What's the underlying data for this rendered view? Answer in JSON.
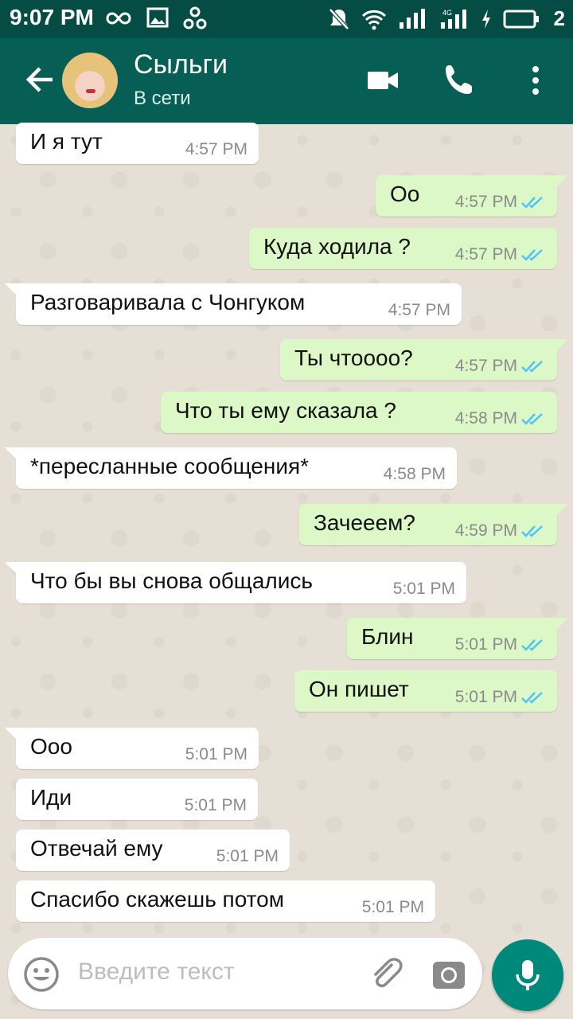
{
  "status_bar": {
    "time": "9:07 PM",
    "battery_level": "2",
    "network_label": "4G"
  },
  "header": {
    "contact_name": "Сыльги",
    "contact_status": "В сети"
  },
  "messages": [
    {
      "dir": "in",
      "text": "И я тут",
      "time": "4:57 PM"
    },
    {
      "dir": "out",
      "text": "Оо",
      "time": "4:57 PM"
    },
    {
      "dir": "out",
      "text": "Куда ходила ?",
      "time": "4:57 PM"
    },
    {
      "dir": "in",
      "text": "Разговаривала с Чонгуком",
      "time": "4:57 PM"
    },
    {
      "dir": "out",
      "text": "Ты чтоооо?",
      "time": "4:57 PM"
    },
    {
      "dir": "out",
      "text": "Что ты ему сказала ?",
      "time": "4:58 PM"
    },
    {
      "dir": "in",
      "text": "*пересланные сообщения*",
      "time": "4:58 PM"
    },
    {
      "dir": "out",
      "text": "Зачееем?",
      "time": "4:59 PM"
    },
    {
      "dir": "in",
      "text": "Что бы вы снова общались",
      "time": "5:01 PM"
    },
    {
      "dir": "out",
      "text": "Блин",
      "time": "5:01 PM"
    },
    {
      "dir": "out",
      "text": "Он пишет",
      "time": "5:01 PM"
    },
    {
      "dir": "in",
      "text": "Ооо",
      "time": "5:01 PM"
    },
    {
      "dir": "in",
      "text": "Иди",
      "time": "5:01 PM"
    },
    {
      "dir": "in",
      "text": "Отвечай ему",
      "time": "5:01 PM"
    },
    {
      "dir": "in",
      "text": "Спасибо скажешь потом",
      "time": "5:01 PM"
    }
  ],
  "composer": {
    "placeholder": "Введите текст"
  },
  "colors": {
    "header": "#075e54",
    "status_bar": "#054d44",
    "outgoing_bubble": "#dcf8c6",
    "incoming_bubble": "#ffffff",
    "read_ticks": "#4fc3f7",
    "mic_button": "#00897b"
  },
  "icons": [
    "back-arrow-icon",
    "video-call-icon",
    "phone-icon",
    "more-options-icon",
    "emoji-icon",
    "attach-icon",
    "camera-icon",
    "mic-icon",
    "double-check-icon"
  ]
}
